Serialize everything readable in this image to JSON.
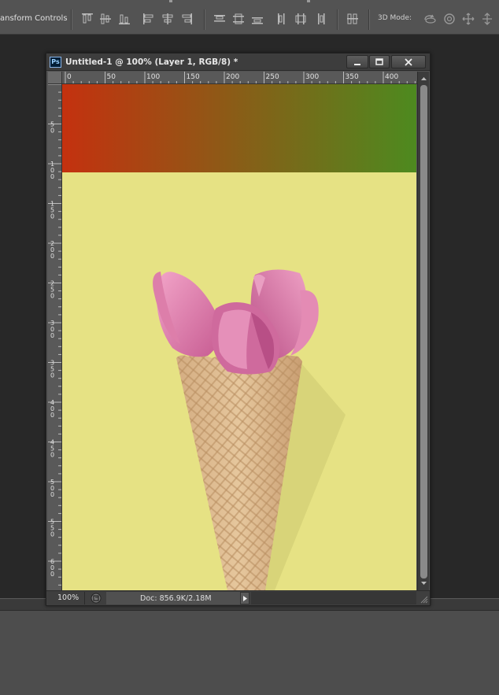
{
  "options_bar": {
    "transform_controls_label": "ansform Controls",
    "mode_label": "3D Mode:",
    "align_icons": [
      "align-top-edges-icon",
      "align-vertical-centers-icon",
      "align-bottom-edges-icon",
      "align-left-edges-icon",
      "align-horizontal-centers-icon",
      "align-right-edges-icon"
    ],
    "distribute_icons": [
      "distribute-top-icon",
      "distribute-vertical-centers-icon",
      "distribute-bottom-icon",
      "distribute-left-icon",
      "distribute-horizontal-centers-icon",
      "distribute-right-icon"
    ],
    "mode_icons": [
      "rotate-3d-icon",
      "roll-3d-icon",
      "drag-3d-icon",
      "slide-3d-icon"
    ]
  },
  "document": {
    "app_badge": "Ps",
    "title": "Untitled-1 @ 100% (Layer 1, RGB/8) *",
    "zoom": "100%",
    "doc_size": "Doc: 856.9K/2.18M",
    "gradient_colors": [
      "#c4310f",
      "#4d8a1f"
    ],
    "background_color": "#e6e284"
  },
  "rulers": {
    "horizontal_labels": [
      "0",
      "50",
      "100",
      "150",
      "200",
      "250",
      "300",
      "350",
      "400"
    ],
    "vertical_labels": [
      "5\n0",
      "1\n0\n0",
      "1\n5\n0",
      "2\n0\n0",
      "2\n5\n0",
      "3\n0\n0",
      "3\n5\n0",
      "4\n0\n0",
      "4\n5\n0",
      "5\n0\n0",
      "5\n5\n0",
      "6\n0\n0"
    ]
  }
}
